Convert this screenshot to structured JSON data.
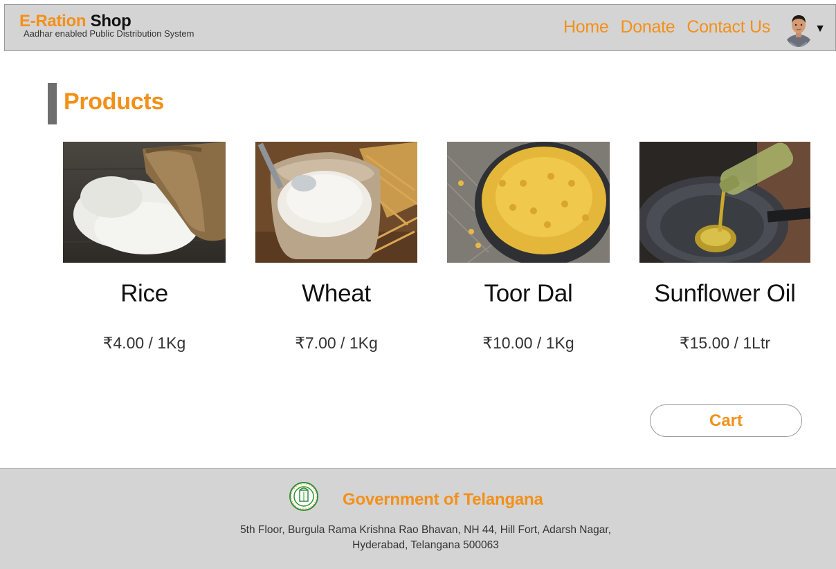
{
  "header": {
    "brand_accent": "E-Ration",
    "brand_dark": "Shop",
    "subtitle": "Aadhar enabled Public Distribution System",
    "nav": [
      "Home",
      "Donate",
      "Contact Us"
    ],
    "user_menu_icon": "caret-down-icon"
  },
  "page": {
    "section_title": "Products"
  },
  "products": [
    {
      "name": "Rice",
      "price": "₹4.00 / 1Kg",
      "image": "rice-sack-photo"
    },
    {
      "name": "Wheat",
      "price": "₹7.00 / 1Kg",
      "image": "wheat-flour-sack-photo"
    },
    {
      "name": "Toor Dal",
      "price": "₹10.00 / 1Kg",
      "image": "toor-dal-bowl-photo"
    },
    {
      "name": "Sunflower Oil",
      "price": "₹15.00 / 1Ltr",
      "image": "oil-pouring-pan-photo"
    }
  ],
  "cart": {
    "label": "Cart"
  },
  "footer": {
    "title": "Government of Telangana",
    "address_line1": "5th Floor, Burgula Rama Krishna Rao Bhavan, NH 44, Hill Fort, Adarsh Nagar,",
    "address_line2": "Hyderabad, Telangana 500063"
  },
  "colors": {
    "accent": "#f39019",
    "header_bg": "#d4d4d4",
    "footer_bg": "#d4d4d4"
  }
}
